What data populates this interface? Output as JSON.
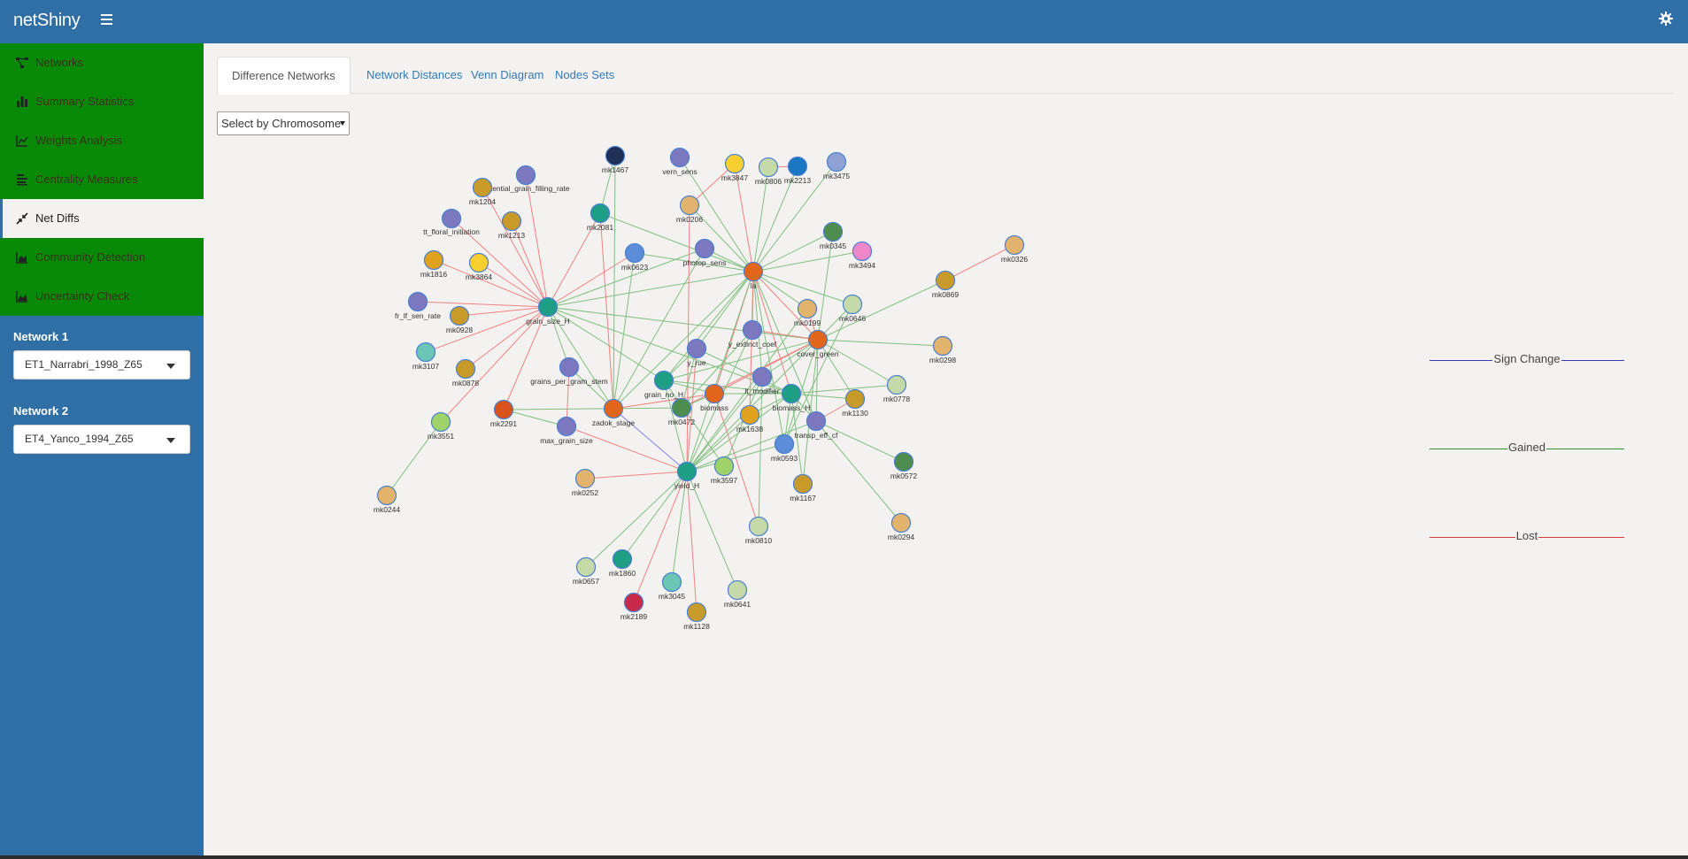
{
  "app": {
    "title": "netShiny"
  },
  "sidebar": {
    "items": [
      {
        "label": "Networks",
        "icon": "network-icon"
      },
      {
        "label": "Summary Statistics",
        "icon": "bar-chart-icon"
      },
      {
        "label": "Weights Analysis",
        "icon": "line-chart-icon"
      },
      {
        "label": "Centrality Measures",
        "icon": "align-left-icon"
      },
      {
        "label": "Net Diffs",
        "icon": "compress-arrows-icon",
        "active": true
      },
      {
        "label": "Community Detection",
        "icon": "area-chart-icon"
      },
      {
        "label": "Uncertainty Check",
        "icon": "mountain-chart-icon"
      }
    ],
    "network1": {
      "label": "Network 1",
      "value": "ET1_Narrabri_1998_Z65"
    },
    "network2": {
      "label": "Network 2",
      "value": "ET4_Yanco_1994_Z65"
    }
  },
  "tabs": [
    {
      "label": "Difference Networks",
      "active": true
    },
    {
      "label": "Network Distances"
    },
    {
      "label": "Venn Diagram"
    },
    {
      "label": "Nodes Sets"
    }
  ],
  "chromosome_select": {
    "value": "Select by Chromosome"
  },
  "legend": [
    {
      "label": "Sign Change",
      "color": "#3b3bb0"
    },
    {
      "label": "Gained",
      "color": "#2f8f2f"
    },
    {
      "label": "Lost",
      "color": "#d43c3c"
    }
  ],
  "colors": {
    "header": "#306fa6",
    "menu": "#088a08",
    "edge_gained": "#7fbf7f",
    "edge_lost": "#f08080",
    "edge_sign": "#8080e0",
    "node_border": "#4a7fd0"
  },
  "network": {
    "nodes": [
      {
        "id": "mk1467",
        "color": "#1f2f55"
      },
      {
        "id": "vern_sens",
        "color": "#7b78c0"
      },
      {
        "id": "mk3847",
        "color": "#f7d030"
      },
      {
        "id": "mk0806",
        "color": "#c6d9a8"
      },
      {
        "id": "mk2213",
        "color": "#1a77c4"
      },
      {
        "id": "mk3475",
        "color": "#8ea3d4"
      },
      {
        "id": "potential_grain_filling_rate",
        "color": "#7b78c0"
      },
      {
        "id": "mk1204",
        "color": "#c89a2a"
      },
      {
        "id": "mk0206",
        "color": "#e2b36c"
      },
      {
        "id": "tt_floral_initiation",
        "color": "#7b78c0"
      },
      {
        "id": "mk1213",
        "color": "#c89a2a"
      },
      {
        "id": "mk2081",
        "color": "#1f9e86"
      },
      {
        "id": "mk0345",
        "color": "#4e8d50"
      },
      {
        "id": "mk3494",
        "color": "#ef86c8"
      },
      {
        "id": "photop_sens",
        "color": "#7b78c0"
      },
      {
        "id": "mk1816",
        "color": "#e0a11c"
      },
      {
        "id": "mk3864",
        "color": "#f7d030"
      },
      {
        "id": "mk0623",
        "color": "#5b8dd8"
      },
      {
        "id": "la",
        "color": "#e2651c"
      },
      {
        "id": "mk0326",
        "color": "#e2b36c"
      },
      {
        "id": "mk0869",
        "color": "#c89a2a"
      },
      {
        "id": "fr_lf_sen_rate",
        "color": "#7b78c0"
      },
      {
        "id": "mk0928",
        "color": "#c89a2a"
      },
      {
        "id": "grain_size_H",
        "color": "#1f9e86"
      },
      {
        "id": "mk0199",
        "color": "#e2b36c"
      },
      {
        "id": "mk0646",
        "color": "#c6d9a8"
      },
      {
        "id": "y_extinct_coef",
        "color": "#7b78c0"
      },
      {
        "id": "cover_green",
        "color": "#e2651c"
      },
      {
        "id": "mk0298",
        "color": "#e2b36c"
      },
      {
        "id": "mk3107",
        "color": "#6cc6b6"
      },
      {
        "id": "y_rue",
        "color": "#7b78c0"
      },
      {
        "id": "mk0878",
        "color": "#c89a2a"
      },
      {
        "id": "grains_per_gram_stem",
        "color": "#7b78c0"
      },
      {
        "id": "grain_no_H",
        "color": "#1f9e86"
      },
      {
        "id": "lt_modifier",
        "color": "#7b78c0"
      },
      {
        "id": "biomass",
        "color": "#e2651c"
      },
      {
        "id": "biomass_H",
        "color": "#1f9e86"
      },
      {
        "id": "mk0778",
        "color": "#c6d9a8"
      },
      {
        "id": "mk1130",
        "color": "#c89a2a"
      },
      {
        "id": "mk2291",
        "color": "#d9541c"
      },
      {
        "id": "zadok_stage",
        "color": "#e2651c"
      },
      {
        "id": "mk0472",
        "color": "#4e8d50"
      },
      {
        "id": "mk1638",
        "color": "#e0a11c"
      },
      {
        "id": "mk3551",
        "color": "#9fd36a"
      },
      {
        "id": "max_grain_size",
        "color": "#7b78c0"
      },
      {
        "id": "transp_eff_cf",
        "color": "#7b78c0"
      },
      {
        "id": "mk0593",
        "color": "#5b8dd8"
      },
      {
        "id": "mk3597",
        "color": "#9fd36a"
      },
      {
        "id": "yield_H",
        "color": "#1f9e86"
      },
      {
        "id": "mk0572",
        "color": "#4e8d50"
      },
      {
        "id": "mk1167",
        "color": "#c89a2a"
      },
      {
        "id": "mk0252",
        "color": "#e2b36c"
      },
      {
        "id": "mk0244",
        "color": "#e2b36c"
      },
      {
        "id": "mk0810",
        "color": "#c6d9a8"
      },
      {
        "id": "mk0294",
        "color": "#e2b36c"
      },
      {
        "id": "mk0657",
        "color": "#c6d9a8"
      },
      {
        "id": "mk1860",
        "color": "#1f9e86"
      },
      {
        "id": "mk3045",
        "color": "#6cc6b6"
      },
      {
        "id": "mk0641",
        "color": "#c6d9a8"
      },
      {
        "id": "mk2189",
        "color": "#c92a4a"
      },
      {
        "id": "mk1128",
        "color": "#c89a2a"
      }
    ],
    "edges": [
      [
        "grain_size_H",
        "mk1204",
        "lost"
      ],
      [
        "grain_size_H",
        "potential_grain_filling_rate",
        "lost"
      ],
      [
        "grain_size_H",
        "tt_floral_initiation",
        "lost"
      ],
      [
        "grain_size_H",
        "mk1213",
        "lost"
      ],
      [
        "grain_size_H",
        "mk2081",
        "lost"
      ],
      [
        "grain_size_H",
        "mk1816",
        "lost"
      ],
      [
        "grain_size_H",
        "mk3864",
        "lost"
      ],
      [
        "grain_size_H",
        "fr_lf_sen_rate",
        "lost"
      ],
      [
        "grain_size_H",
        "mk0928",
        "lost"
      ],
      [
        "grain_size_H",
        "mk3107",
        "lost"
      ],
      [
        "grain_size_H",
        "mk0878",
        "lost"
      ],
      [
        "grain_size_H",
        "mk2291",
        "lost"
      ],
      [
        "grain_size_H",
        "mk3551",
        "lost"
      ],
      [
        "grain_size_H",
        "mk0623",
        "lost"
      ],
      [
        "grain_size_H",
        "photop_sens",
        "gained"
      ],
      [
        "grain_size_H",
        "grains_per_gram_stem",
        "gained"
      ],
      [
        "grain_size_H",
        "zadok_stage",
        "gained"
      ],
      [
        "grain_size_H",
        "grain_no_H",
        "gained"
      ],
      [
        "grain_size_H",
        "biomass_H",
        "gained"
      ],
      [
        "grain_size_H",
        "cover_green",
        "gained"
      ],
      [
        "grain_size_H",
        "la",
        "gained"
      ],
      [
        "mk3551",
        "mk0244",
        "gained"
      ],
      [
        "mk2081",
        "mk1467",
        "gained"
      ],
      [
        "mk2081",
        "zadok_stage",
        "lost"
      ],
      [
        "la",
        "vern_sens",
        "gained"
      ],
      [
        "la",
        "mk3847",
        "lost"
      ],
      [
        "la",
        "mk0806",
        "gained"
      ],
      [
        "la",
        "mk2213",
        "gained"
      ],
      [
        "la",
        "mk3475",
        "gained"
      ],
      [
        "la",
        "mk0206",
        "gained"
      ],
      [
        "la",
        "mk0345",
        "gained"
      ],
      [
        "la",
        "mk3494",
        "gained"
      ],
      [
        "la",
        "photop_sens",
        "gained"
      ],
      [
        "la",
        "mk0623",
        "gained"
      ],
      [
        "la",
        "mk0199",
        "gained"
      ],
      [
        "la",
        "mk0646",
        "gained"
      ],
      [
        "la",
        "cover_green",
        "lost"
      ],
      [
        "la",
        "y_extinct_coef",
        "gained"
      ],
      [
        "la",
        "y_rue",
        "gained"
      ],
      [
        "la",
        "grain_no_H",
        "gained"
      ],
      [
        "la",
        "biomass",
        "lost"
      ],
      [
        "la",
        "biomass_H",
        "lost"
      ],
      [
        "la",
        "lt_modifier",
        "gained"
      ],
      [
        "la",
        "zadok_stage",
        "gained"
      ],
      [
        "la",
        "yield_H",
        "gained"
      ],
      [
        "la",
        "mk1638",
        "lost"
      ],
      [
        "la",
        "mk0593",
        "gained"
      ],
      [
        "la",
        "transp_eff_cf",
        "gained"
      ],
      [
        "la",
        "mk2081",
        "gained"
      ],
      [
        "mk0206",
        "yield_H",
        "lost"
      ],
      [
        "mk0206",
        "mk3847",
        "lost"
      ],
      [
        "mk2213",
        "mk0806",
        "lost"
      ],
      [
        "cover_green",
        "mk0869",
        "gained"
      ],
      [
        "cover_green",
        "mk0298",
        "gained"
      ],
      [
        "cover_green",
        "y_extinct_coef",
        "lost"
      ],
      [
        "cover_green",
        "mk0778",
        "gained"
      ],
      [
        "cover_green",
        "mk1130",
        "gained"
      ],
      [
        "cover_green",
        "biomass",
        "lost"
      ],
      [
        "cover_green",
        "grain_no_H",
        "gained"
      ],
      [
        "cover_green",
        "mk0646",
        "gained"
      ],
      [
        "cover_green",
        "mk0199",
        "lost"
      ],
      [
        "cover_green",
        "mk0345",
        "gained"
      ],
      [
        "cover_green",
        "mk0593",
        "gained"
      ],
      [
        "cover_green",
        "yield_H",
        "gained"
      ],
      [
        "cover_green",
        "transp_eff_cf",
        "gained"
      ],
      [
        "cover_green",
        "mk1167",
        "gained"
      ],
      [
        "cover_green",
        "lt_modifier",
        "gained"
      ],
      [
        "cover_green",
        "mk0472",
        "lost"
      ],
      [
        "mk0869",
        "mk0326",
        "lost"
      ],
      [
        "y_rue",
        "yield_H",
        "lost"
      ],
      [
        "y_rue",
        "biomass_H",
        "gained"
      ],
      [
        "y_rue",
        "mk0472",
        "gained"
      ],
      [
        "y_rue",
        "grain_no_H",
        "gained"
      ],
      [
        "zadok_stage",
        "yield_H",
        "sign"
      ],
      [
        "zadok_stage",
        "biomass",
        "lost"
      ],
      [
        "zadok_stage",
        "mk0623",
        "gained"
      ],
      [
        "zadok_stage",
        "photop_sens",
        "gained"
      ],
      [
        "zadok_stage",
        "mk1467",
        "gained"
      ],
      [
        "max_grain_size",
        "mk2291",
        "gained"
      ],
      [
        "max_grain_size",
        "yield_H",
        "lost"
      ],
      [
        "max_grain_size",
        "grains_per_gram_stem",
        "lost"
      ],
      [
        "grain_no_H",
        "biomass_H",
        "gained"
      ],
      [
        "grain_no_H",
        "yield_H",
        "gained"
      ],
      [
        "grain_no_H",
        "mk3597",
        "gained"
      ],
      [
        "grain_no_H",
        "biomass",
        "gained"
      ],
      [
        "biomass",
        "mk0810",
        "lost"
      ],
      [
        "biomass",
        "biomass_H",
        "gained"
      ],
      [
        "biomass",
        "mk0472",
        "gained"
      ],
      [
        "biomass_H",
        "mk1130",
        "gained"
      ],
      [
        "biomass_H",
        "mk0593",
        "gained"
      ],
      [
        "biomass_H",
        "transp_eff_cf",
        "gained"
      ],
      [
        "biomass_H",
        "mk0778",
        "gained"
      ],
      [
        "biomass_H",
        "yield_H",
        "gained"
      ],
      [
        "biomass_H",
        "mk1167",
        "gained"
      ],
      [
        "biomass_H",
        "mk1638",
        "gained"
      ],
      [
        "lt_modifier",
        "yield_H",
        "gained"
      ],
      [
        "lt_modifier",
        "mk3597",
        "gained"
      ],
      [
        "lt_modifier",
        "mk0810",
        "gained"
      ],
      [
        "transp_eff_cf",
        "mk0572",
        "gained"
      ],
      [
        "transp_eff_cf",
        "mk0294",
        "gained"
      ],
      [
        "transp_eff_cf",
        "yield_H",
        "gained"
      ],
      [
        "transp_eff_cf",
        "mk1130",
        "lost"
      ],
      [
        "yield_H",
        "mk0252",
        "lost"
      ],
      [
        "yield_H",
        "mk0657",
        "gained"
      ],
      [
        "yield_H",
        "mk1860",
        "gained"
      ],
      [
        "yield_H",
        "mk3045",
        "gained"
      ],
      [
        "yield_H",
        "mk0641",
        "gained"
      ],
      [
        "yield_H",
        "mk2189",
        "lost"
      ],
      [
        "yield_H",
        "mk1128",
        "lost"
      ],
      [
        "yield_H",
        "mk1638",
        "gained"
      ],
      [
        "yield_H",
        "mk0593",
        "gained"
      ],
      [
        "y_extinct_coef",
        "yield_H",
        "gained"
      ],
      [
        "y_extinct_coef",
        "mk0472",
        "gained"
      ],
      [
        "mk0199",
        "yield_H",
        "gained"
      ],
      [
        "mk0646",
        "mk0593",
        "gained"
      ],
      [
        "grains_per_gram_stem",
        "zadok_stage",
        "gained"
      ],
      [
        "mk2291",
        "mk0472",
        "gained"
      ]
    ]
  }
}
